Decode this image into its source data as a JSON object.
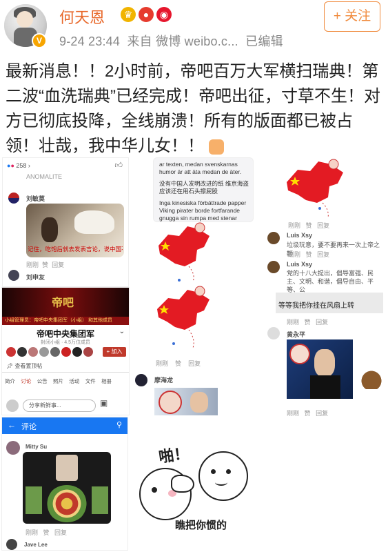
{
  "author": {
    "name": "何天恩",
    "verified_badge": "V",
    "time": "9-24 23:44",
    "source": "来自 微博 weibo.c...",
    "edited": "已编辑"
  },
  "follow_button": "+ 关注",
  "post_text": "最新消息！！2小时前，帝吧百万大军横扫瑞典！第二波“血洗瑞典”已经完成！帝吧出征，寸草不生！对方已彻底投降，全线崩溃！所有的版面都已被占领！壮哉，我中华儿女！！",
  "icons": {
    "crown": "crown-icon",
    "bulb": "lightbulb-icon",
    "weibo": "weibo-icon",
    "emoji": "hands-emoji-icon"
  },
  "img1": {
    "count": "258",
    "comment_head": "ANOMALITE",
    "user1": "刘敏莫",
    "like_reply": [
      "刚刚",
      "赞",
      "回复"
    ],
    "caption": "记住，吃饱后就去发表言论，说中国不好",
    "user2": "刘申友"
  },
  "img2": {
    "lines": [
      "ar texten, medan svenskarnas",
      "humor är att äta medan de äter.",
      "没有中国人发明改进的纸 维京海盗",
      "应该还在用石头擦屁股",
      "Inga kinesiska förbättrade papper",
      "Viking pirater borde fortfarande",
      "gnugga sin rumpa med stenar"
    ]
  },
  "img3": {
    "user1": "Luis Xsy",
    "text1": "垃圾玩意，要不要再来一次上帝之鞭",
    "user2": "Luis Xsy",
    "text2": "党的十八大提出，倡导富强、民主、文明、和谐，倡导自由、平等、公",
    "caption": "等等我把你挂在风扇上转",
    "user3": "黄永平",
    "row": [
      "刚刚",
      "赞",
      "回复"
    ]
  },
  "img4": {
    "banner": "帝吧",
    "admin_line": "小组管理员：帝吧中央集团军（小组） 和其他成员",
    "group_name": "帝吧中央集团军",
    "group_sub": "封闭小组 · 4.5万位成员",
    "join": "+ 加入",
    "pinned": "查看置顶帖",
    "tabs": [
      "简介",
      "讨论",
      "公告",
      "照片",
      "活动",
      "文件",
      "相册"
    ],
    "compose": "分享新鲜事..."
  },
  "img5": {
    "title": "评论",
    "user1": "Mitty Su",
    "user2": "Jave Lee"
  },
  "img6": {
    "user": "摩海龙",
    "row": [
      "刚刚",
      "赞",
      "回复"
    ]
  },
  "img7": {
    "shout": "啪！",
    "caption": "瞧把你惯的"
  },
  "colors": {
    "brand": "#e8682a",
    "chinaRed": "#e31b23",
    "yellow": "#ffde00",
    "fbBlue": "#1877f2"
  }
}
